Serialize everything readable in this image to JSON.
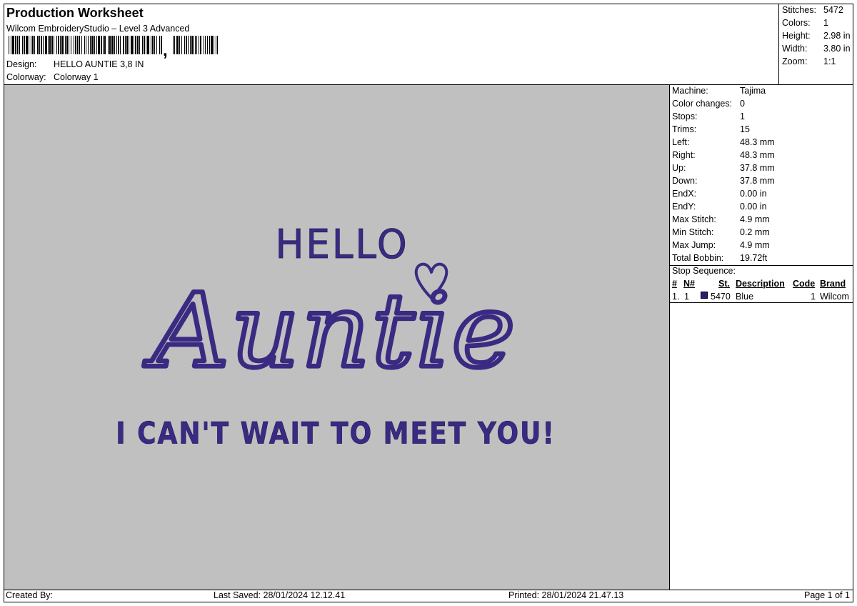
{
  "header": {
    "title": "Production Worksheet",
    "software": "Wilcom EmbroideryStudio – Level 3 Advanced",
    "design_label": "Design:",
    "design_value": "HELLO AUNTIE 3,8 IN",
    "colorway_label": "Colorway:",
    "colorway_value": "Colorway 1"
  },
  "summary": {
    "stitches_label": "Stitches:",
    "stitches_value": "5472",
    "colors_label": "Colors:",
    "colors_value": "1",
    "height_label": "Height:",
    "height_value": "2.98 in",
    "width_label": "Width:",
    "width_value": "3.80 in",
    "zoom_label": "Zoom:",
    "zoom_value": "1:1"
  },
  "design": {
    "line1": "HELLO",
    "line2": "Auntie",
    "line3": "I CAN'T WAIT TO MEET YOU!",
    "thread_color": "#3b2a82",
    "background_color": "#c0c0c0"
  },
  "properties": [
    {
      "label": "Machine:",
      "value": "Tajima"
    },
    {
      "label": "Color changes:",
      "value": "0"
    },
    {
      "label": "Stops:",
      "value": "1"
    },
    {
      "label": "Trims:",
      "value": "15"
    },
    {
      "label": "Left:",
      "value": "48.3 mm"
    },
    {
      "label": "Right:",
      "value": "48.3 mm"
    },
    {
      "label": "Up:",
      "value": "37.8 mm"
    },
    {
      "label": "Down:",
      "value": "37.8 mm"
    },
    {
      "label": "EndX:",
      "value": "0.00 in"
    },
    {
      "label": "EndY:",
      "value": "0.00 in"
    },
    {
      "label": "Max Stitch:",
      "value": "4.9 mm"
    },
    {
      "label": "Min Stitch:",
      "value": "0.2 mm"
    },
    {
      "label": "Max Jump:",
      "value": "4.9 mm"
    },
    {
      "label": "Total Bobbin:",
      "value": "19.72ft"
    }
  ],
  "stop_sequence": {
    "title": "Stop Sequence:",
    "columns": {
      "num": "#",
      "needle": "N#",
      "st": "St.",
      "description": "Description",
      "code": "Code",
      "brand": "Brand"
    },
    "rows": [
      {
        "num": "1.",
        "needle": "1",
        "st": "5470",
        "description": "Blue",
        "code": "1",
        "brand": "Wilcom",
        "color": "#2e1a78"
      }
    ]
  },
  "footer": {
    "created_by": "Created By:",
    "last_saved": "Last Saved: 28/01/2024 12.12.41",
    "printed": "Printed: 28/01/2024 21.47.13",
    "page": "Page 1 of 1"
  }
}
